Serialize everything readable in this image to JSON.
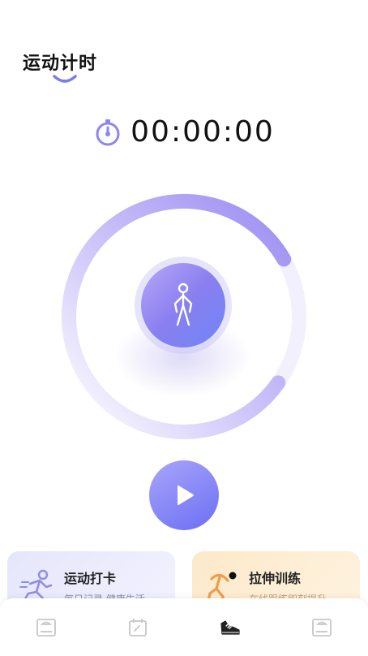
{
  "header": {
    "title": "运动计时"
  },
  "timer": {
    "value": "00:00:00",
    "icon": "stopwatch-icon"
  },
  "ring": {
    "progress_percent": 82,
    "accent_start": "#b9aef6",
    "accent_end": "#8c7ef1"
  },
  "actions": {
    "center_icon": "person-standing-icon",
    "play_icon": "play-icon"
  },
  "cards": [
    {
      "title": "运动打卡",
      "subtitle": "每日记录 健康生活",
      "icon": "running-icon"
    },
    {
      "title": "拉伸训练",
      "subtitle": "在线跟练即刻提升",
      "icon": "stretching-icon"
    }
  ],
  "tabbar": {
    "items": [
      {
        "icon": "scale-icon",
        "active": false
      },
      {
        "icon": "calendar-check-icon",
        "active": false
      },
      {
        "icon": "sneaker-icon",
        "active": true
      },
      {
        "icon": "scale-icon",
        "active": false
      }
    ]
  }
}
